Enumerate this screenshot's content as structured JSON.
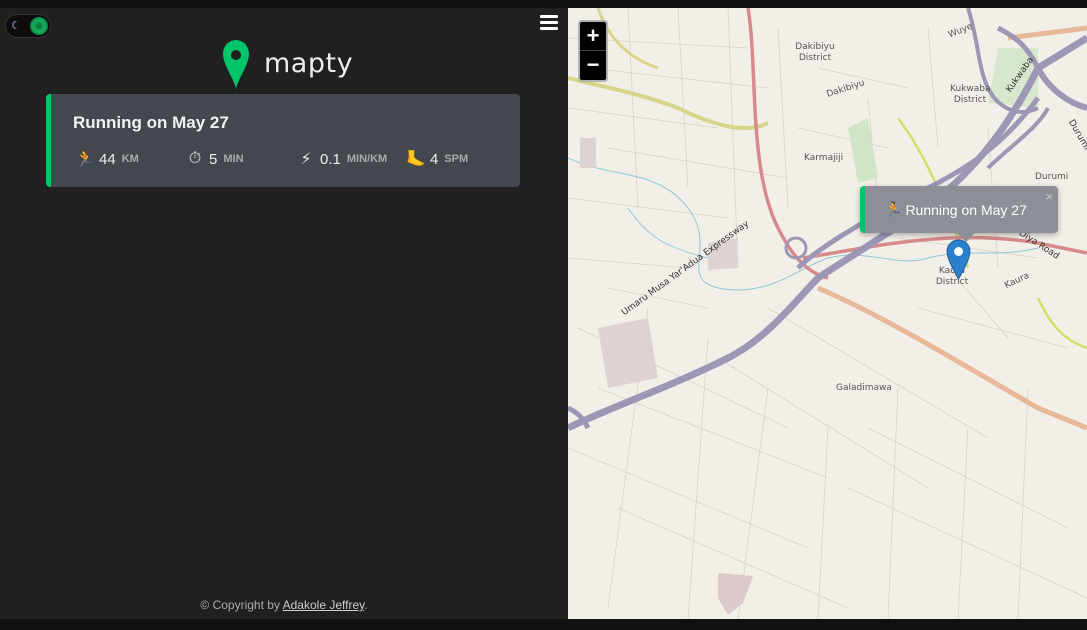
{
  "sidebar": {
    "logo_text": "mapty",
    "copyright_prefix": "© Copyright by ",
    "copyright_author": "Adakole Jeffrey",
    "copyright_suffix": "."
  },
  "workout": {
    "title": "Running on May 27",
    "details": [
      {
        "icon": "🏃",
        "value": "44",
        "unit": "KM"
      },
      {
        "icon": "⏱",
        "value": "5",
        "unit": "MIN"
      },
      {
        "icon": "⚡",
        "value": "0.1",
        "unit": "MIN/KM"
      },
      {
        "icon": "🦶",
        "value": "4",
        "unit": "SPM"
      }
    ]
  },
  "map": {
    "zoom_in": "+",
    "zoom_out": "−",
    "popup": {
      "icon": "🏃",
      "text": "Running on May 27",
      "close": "×"
    },
    "labels": {
      "dakibiyu_district": "Dakibiyu District",
      "dakibiyu": "Dakibiyu",
      "kukwaba_district": "Kukwaba District",
      "karmajiji": "Karmajiji",
      "durumi": "Durumi",
      "kaura_district": "Kaura District",
      "kaura": "Kaura",
      "galadimawa": "Galadimawa",
      "wuye": "Wuye",
      "expressway": "Umaru Musa Yar'Adua Expressway",
      "diya_road": "Diya Road",
      "kukwaba_road": "Kukwaba",
      "durumi_road": "Durumi"
    }
  },
  "colors": {
    "accent_green": "#00c46a",
    "sidebar_bg": "#202020",
    "card_bg": "#42484d",
    "map_bg": "#f2efe9"
  }
}
